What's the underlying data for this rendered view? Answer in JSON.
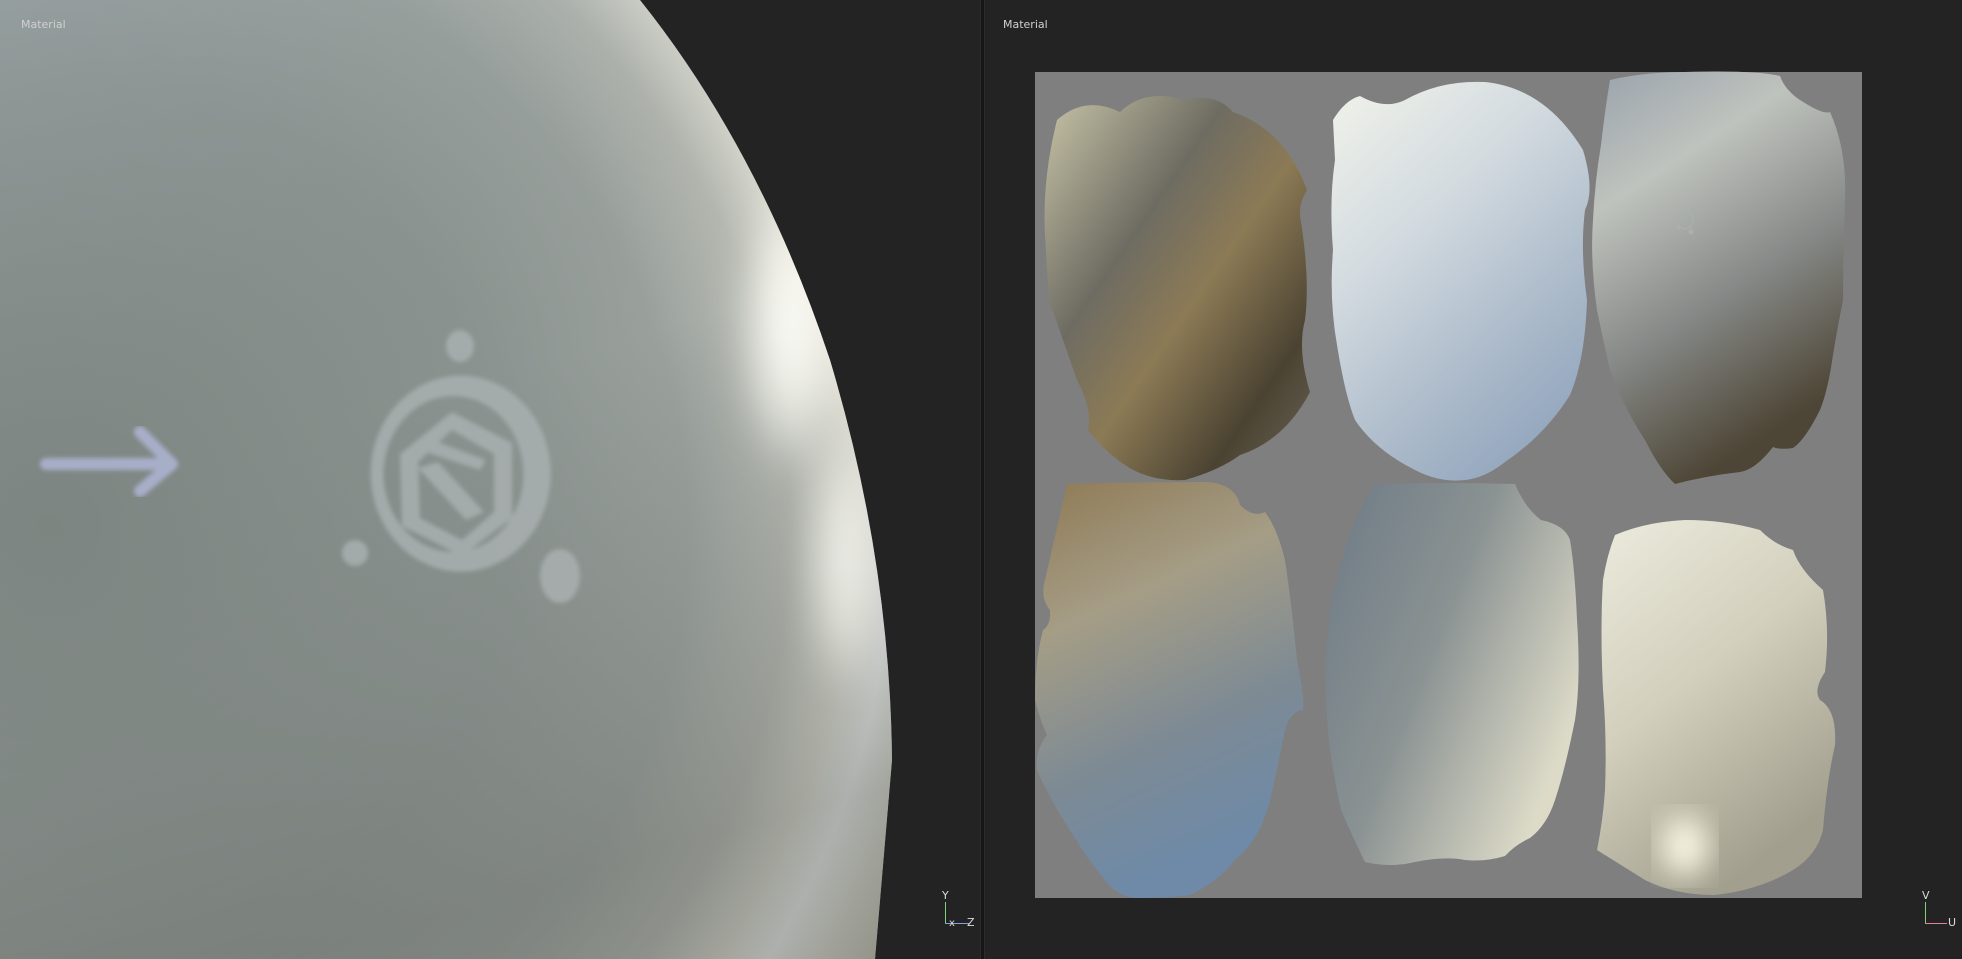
{
  "viewports": {
    "left": {
      "label": "Material",
      "axis_up": "Y",
      "axis_right": "Z",
      "axis_depth": "x"
    },
    "right": {
      "label": "Material",
      "axis_up": "V",
      "axis_right": "U"
    }
  },
  "colors": {
    "background": "#232323",
    "sphere_base": "#8a918f",
    "arrow": "#a7aec8",
    "logo": "#a9b0b0",
    "uv_canvas": "#7f7f7f",
    "highlight": "#ffffff"
  },
  "icons": {
    "left_arrow": "arrow-right-icon",
    "left_logo": "substance-logo-icon",
    "right_logo": "substance-logo-icon",
    "gizmo": "axis-gizmo-icon"
  }
}
